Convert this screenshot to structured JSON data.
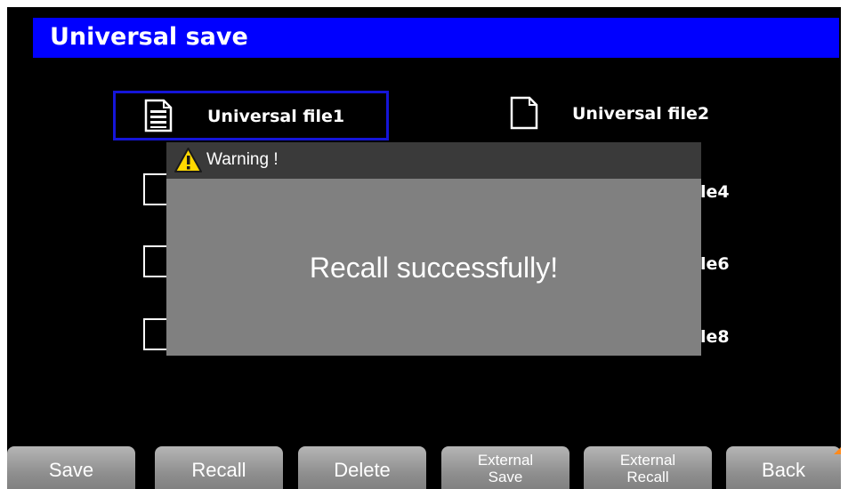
{
  "page": {
    "title": "Universal save"
  },
  "files": [
    {
      "label": "Universal file1",
      "selected": true,
      "icon": "document-with-lines-icon"
    },
    {
      "label": "Universal file2",
      "selected": false,
      "icon": "blank-document-icon"
    }
  ],
  "partially_visible": {
    "file4_suffix": "le4",
    "file6_suffix": "le6",
    "file8_suffix": "le8"
  },
  "dialog": {
    "title": "Warning !",
    "message": "Recall successfully!",
    "icon": "warning-triangle-icon"
  },
  "softkeys": {
    "save": "Save",
    "recall": "Recall",
    "delete": "Delete",
    "external_save_line1": "External",
    "external_save_line2": "Save",
    "external_recall_line1": "External",
    "external_recall_line2": "Recall",
    "back": "Back"
  },
  "colors": {
    "title_bar": "#0000ff",
    "selection_border": "#1515d8",
    "dialog_body": "#808080",
    "dialog_header": "#3a3a3a",
    "warning_icon": "#ffd800",
    "back_marker": "#ff8a1c"
  }
}
